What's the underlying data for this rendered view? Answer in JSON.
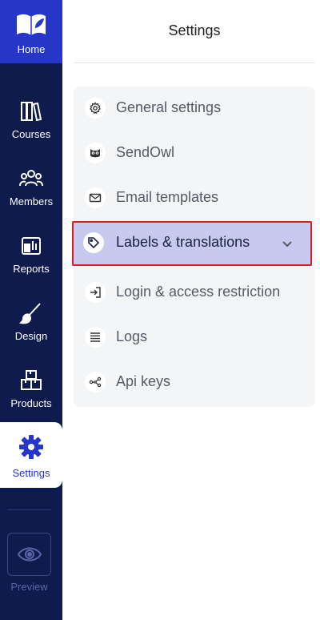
{
  "sidebar": {
    "home_label": "Home",
    "items": [
      {
        "id": "courses",
        "label": "Courses",
        "icon": "books-icon"
      },
      {
        "id": "members",
        "label": "Members",
        "icon": "members-icon"
      },
      {
        "id": "reports",
        "label": "Reports",
        "icon": "reports-icon"
      },
      {
        "id": "design",
        "label": "Design",
        "icon": "brush-icon"
      },
      {
        "id": "products",
        "label": "Products",
        "icon": "boxes-icon"
      }
    ],
    "active": {
      "label": "Settings",
      "icon": "gear-icon"
    },
    "preview_label": "Preview"
  },
  "main": {
    "title": "Settings",
    "menu": [
      {
        "label": "General settings",
        "icon": "gear-small-icon"
      },
      {
        "label": "SendOwl",
        "icon": "owl-icon"
      },
      {
        "label": "Email templates",
        "icon": "envelope-icon"
      },
      {
        "label": "Labels & translations",
        "icon": "tag-icon",
        "active": true
      },
      {
        "label": "Login & access restriction",
        "icon": "login-icon"
      },
      {
        "label": "Logs",
        "icon": "list-icon"
      },
      {
        "label": "Api keys",
        "icon": "share-nodes-icon"
      }
    ]
  },
  "colors": {
    "sidebar_bg": "#0f1b4d",
    "brand_blue": "#2536c9",
    "menu_bg": "#f3f5f7",
    "active_bg": "#c7c9ee",
    "highlight_border": "#d32020"
  }
}
